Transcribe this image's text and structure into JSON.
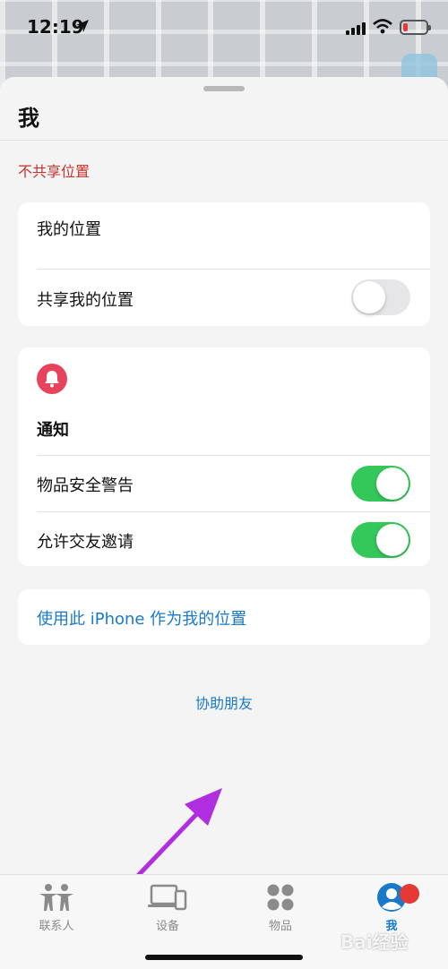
{
  "status_bar": {
    "time": "12:19"
  },
  "sheet": {
    "title": "我",
    "section_label": "不共享位置",
    "location_card": {
      "my_location_label": "我的位置",
      "share_label": "共享我的位置",
      "share_enabled": false
    },
    "notifications_card": {
      "title": "通知",
      "items": [
        {
          "label": "物品安全警告",
          "enabled": true
        },
        {
          "label": "允许交友邀请",
          "enabled": true
        }
      ]
    },
    "use_iphone_link": "使用此 iPhone 作为我的位置",
    "help_friend_link": "协助朋友"
  },
  "tab_bar": {
    "tabs": [
      {
        "label": "联系人",
        "icon": "people-icon"
      },
      {
        "label": "设备",
        "icon": "devices-icon"
      },
      {
        "label": "物品",
        "icon": "items-grid-icon"
      },
      {
        "label": "我",
        "icon": "person-circle-icon",
        "active": true
      }
    ]
  },
  "watermark": "Bai经验",
  "colors": {
    "accent_blue": "#1a7ac9",
    "toggle_on": "#34c759",
    "warning_red": "#c8322a",
    "bell_red": "#e8435c",
    "arrow_purple": "#b12ee0"
  }
}
